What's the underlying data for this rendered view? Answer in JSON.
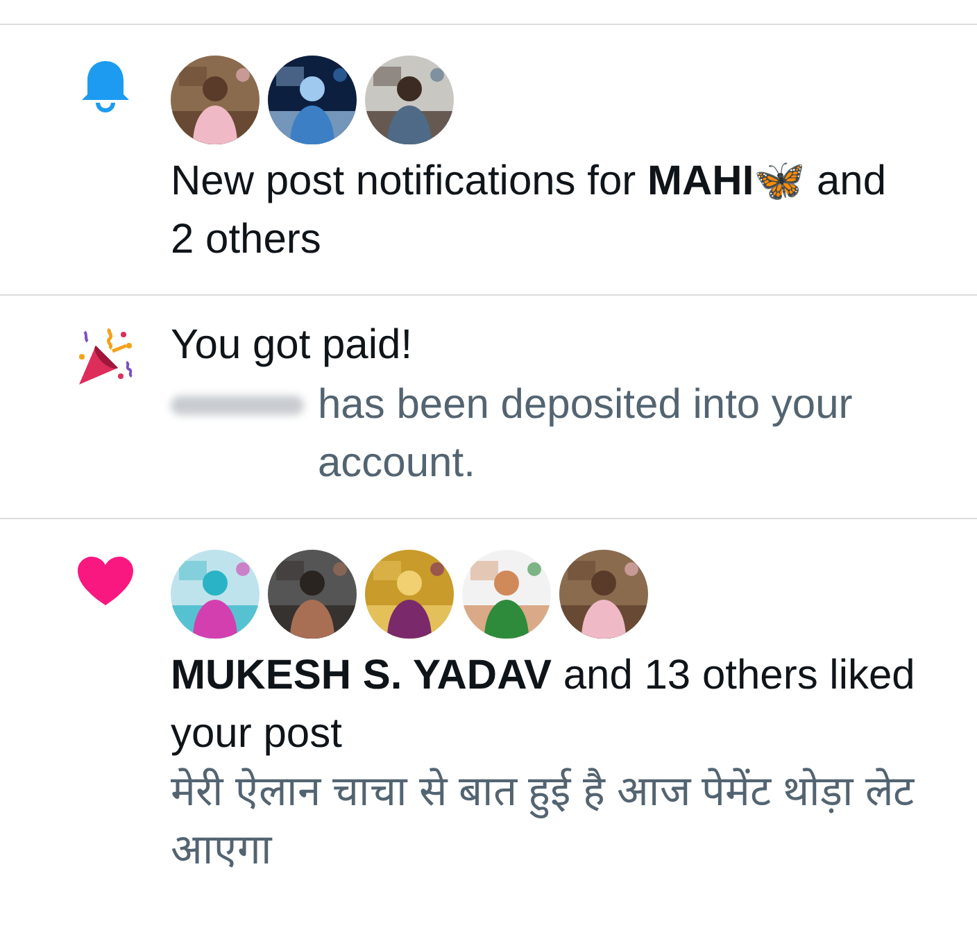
{
  "notifications": [
    {
      "kind": "post",
      "text": "New post notifications for **MAHI🦋** and 2 others"
    },
    {
      "kind": "paid",
      "title": "You got paid!",
      "redacted": true,
      "text": "has been deposited into your account."
    },
    {
      "kind": "like",
      "text": "**MUKESH S. YADAV** and 13 others liked your post",
      "quote": "मेरी ऐलान चाचा से बात हुई है आज पेमेंट थोड़ा लेट आएगा"
    }
  ]
}
